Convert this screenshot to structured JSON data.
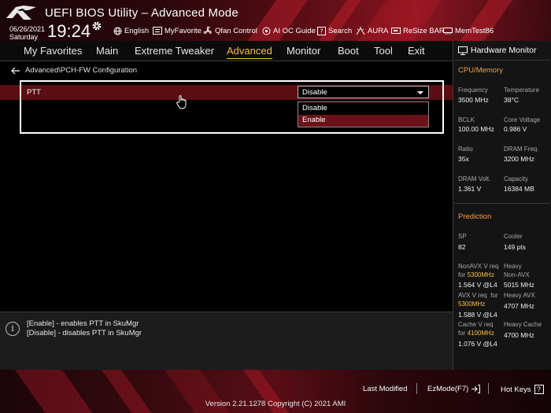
{
  "header": {
    "title": "UEFI BIOS Utility – Advanced Mode",
    "date": "06/26/2021",
    "day": "Saturday",
    "time": "19:24",
    "quick_items": [
      {
        "label": "English",
        "icon": "globe-icon"
      },
      {
        "label": "MyFavorite",
        "icon": "myfavorite-icon"
      },
      {
        "label": "Qfan Control",
        "icon": "fan-icon"
      },
      {
        "label": "AI OC Guide",
        "icon": "ai-oc-guide-icon"
      },
      {
        "label": "Search",
        "icon": "search-icon"
      },
      {
        "label": "AURA",
        "icon": "aura-icon"
      },
      {
        "label": "ReSize BAR",
        "icon": "resize-bar-icon"
      },
      {
        "label": "MemTest86",
        "icon": "memtest-icon"
      }
    ]
  },
  "menu": [
    {
      "label": "My Favorites",
      "active": false
    },
    {
      "label": "Main",
      "active": false
    },
    {
      "label": "Extreme Tweaker",
      "active": false
    },
    {
      "label": "Advanced",
      "active": true
    },
    {
      "label": "Monitor",
      "active": false
    },
    {
      "label": "Boot",
      "active": false
    },
    {
      "label": "Tool",
      "active": false
    },
    {
      "label": "Exit",
      "active": false
    }
  ],
  "breadcrumb": "Advanced\\PCH-FW Configuration",
  "setting": {
    "label": "PTT",
    "value": "Disable",
    "options": [
      "Disable",
      "Enable"
    ],
    "hovered_option": "Enable"
  },
  "help": {
    "lines": [
      "[Enable] - enables PTT in SkuMgr",
      "[Disable] - disables PTT in SkuMgr"
    ]
  },
  "hardware_monitor": {
    "title": "Hardware Monitor",
    "cpu_section": "CPU/Memory",
    "cpu": [
      {
        "label": "Frequency",
        "value": "3500 MHz"
      },
      {
        "label": "Temperature",
        "value": "38°C"
      },
      {
        "label": "BCLK",
        "value": "100.00 MHz"
      },
      {
        "label": "Core Voltage",
        "value": "0.986 V"
      },
      {
        "label": "Ratio",
        "value": "35x"
      },
      {
        "label": "DRAM Freq.",
        "value": "3200 MHz"
      },
      {
        "label": "DRAM Volt.",
        "value": "1.361 V"
      },
      {
        "label": "Capacity",
        "value": "16384 MB"
      }
    ],
    "prediction_section": "Prediction",
    "sp": {
      "label": "SP",
      "value": "82"
    },
    "cooler": {
      "label": "Cooler",
      "value": "149 pts"
    },
    "nonavx": {
      "label_a": "NonAVX V req",
      "label_b": "for",
      "freq": "5300MHz",
      "value": "1.564 V @L4"
    },
    "heavy_nonavx": {
      "label_a": "Heavy",
      "label_b": "Non-AVX",
      "value": "5015 MHz"
    },
    "avx": {
      "label_a": "AVX V req",
      "label_b": "for",
      "freq": "5300MHz",
      "value": "1.588 V @L4"
    },
    "heavy_avx": {
      "label": "Heavy AVX",
      "value": "4707 MHz"
    },
    "cache": {
      "label_a": "Cache V req",
      "label_b": "for",
      "freq": "4100MHz",
      "value": "1.076 V @L4"
    },
    "heavy_cache": {
      "label": "Heavy Cache",
      "value": "4700 MHz"
    }
  },
  "footer": {
    "last_modified": "Last Modified",
    "ezmode": "EzMode(F7)",
    "hotkeys": "Hot Keys",
    "hotkeys_key": "?",
    "version": "Version 2.21.1278 Copyright (C) 2021 AMI"
  },
  "colors": {
    "accent": "#f5c040",
    "section_orange": "#f0a040",
    "highlight_row": "#5b0d11",
    "dropdown_hover": "#6a1218"
  }
}
